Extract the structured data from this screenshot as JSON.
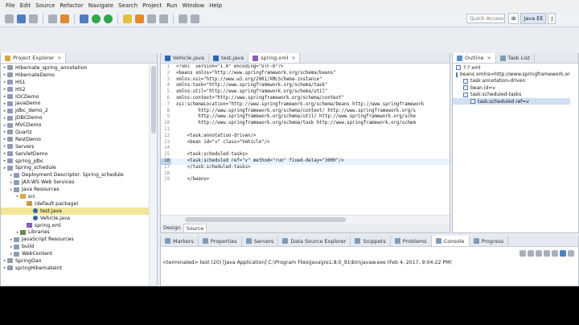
{
  "menu": [
    "File",
    "Edit",
    "Source",
    "Refactor",
    "Navigate",
    "Search",
    "Project",
    "Run",
    "Window",
    "Help"
  ],
  "toolbar": {
    "quick_access": "Quick Access",
    "perspective_label": "Java EE"
  },
  "project_explorer": {
    "tab_label": "Project Explorer",
    "items": [
      {
        "label": "Hibernate_spring_annotation",
        "depth": 0
      },
      {
        "label": "HibernateDemo",
        "depth": 0
      },
      {
        "label": "HS1",
        "depth": 0
      },
      {
        "label": "HS2",
        "depth": 0
      },
      {
        "label": "IOCDemo",
        "depth": 0
      },
      {
        "label": "JavaDemo",
        "depth": 0
      },
      {
        "label": "Jdbc_demo_2",
        "depth": 0
      },
      {
        "label": "JDBCDemo",
        "depth": 0
      },
      {
        "label": "MVCDemo",
        "depth": 0
      },
      {
        "label": "Quartz",
        "depth": 0
      },
      {
        "label": "RestDemo",
        "depth": 0
      },
      {
        "label": "Servers",
        "depth": 0
      },
      {
        "label": "ServletDemo",
        "depth": 0
      },
      {
        "label": "spring_jdbc",
        "depth": 0
      },
      {
        "label": "Spring_schedule",
        "depth": 0
      },
      {
        "label": "Deployment Descriptor: Spring_schedule",
        "depth": 1
      },
      {
        "label": "JAX-WS Web Services",
        "depth": 1
      },
      {
        "label": "Java Resources",
        "depth": 1
      },
      {
        "label": "src",
        "depth": 2
      },
      {
        "label": "(default package)",
        "depth": 3
      },
      {
        "label": "test.java",
        "depth": 4
      },
      {
        "label": "Vehicle.java",
        "depth": 4
      },
      {
        "label": "spring.xml",
        "depth": 3
      },
      {
        "label": "Libraries",
        "depth": 2
      },
      {
        "label": "JavaScript Resources",
        "depth": 1
      },
      {
        "label": "build",
        "depth": 1
      },
      {
        "label": "WebContent",
        "depth": 1
      },
      {
        "label": "SpringDao",
        "depth": 0
      },
      {
        "label": "springHibernateInt",
        "depth": 0
      }
    ]
  },
  "editor": {
    "tabs": [
      {
        "label": "Vehicle.java"
      },
      {
        "label": "test.java"
      },
      {
        "label": "spring.xml"
      }
    ],
    "lines": [
      {
        "num": "1",
        "text": "<?xml  version=\"1.0\" encoding=\"UTF-8\"?>"
      },
      {
        "num": "2",
        "text": "<beans xmlns=\"http://www.springframework.org/schema/beans\""
      },
      {
        "num": "3",
        "text": "xmlns:xsi=\"http://www.w3.org/2001/XMLSchema-instance\""
      },
      {
        "num": "4",
        "text": "xmlns:task=\"http://www.springframework.org/schema/task\""
      },
      {
        "num": "5",
        "text": "xmlns:util=\"http://www.springframework.org/schema/util\""
      },
      {
        "num": "6",
        "text": "xmlns:context=\"http://www.springframework.org/schema/context\""
      },
      {
        "num": "7",
        "text": "xsi:schemaLocation=\"http://www.springframework.org/schema/beans http://www.springframework"
      },
      {
        "num": "8",
        "text": "        http://www.springframework.org/schema/context/ http://www.springframework.org/s"
      },
      {
        "num": "9",
        "text": "        http://www.springframework.org/schema/util/ http://www.springframework.org/sche"
      },
      {
        "num": "10",
        "text": "        http://www.springframework.org/schema/task http://www.springframework.org/schem"
      },
      {
        "num": "11",
        "text": ""
      },
      {
        "num": "12",
        "text": "    <task:annotation-driven/>"
      },
      {
        "num": "13",
        "text": "    <bean id=\"v\" class=\"Vehicle\"/>"
      },
      {
        "num": "14",
        "text": ""
      },
      {
        "num": "15",
        "text": "    <task:scheduled-tasks>"
      },
      {
        "num": "16",
        "text": "    <task:scheduled ref=\"v\" method=\"run\" fixed-delay=\"3000\"/>"
      },
      {
        "num": "17",
        "text": "    </task:scheduled-tasks>"
      },
      {
        "num": "18",
        "text": ""
      },
      {
        "num": "19",
        "text": "    </beans>"
      }
    ],
    "mode_tabs": [
      "Design",
      "Source"
    ]
  },
  "outline": {
    "tabs": [
      "Outline",
      "Task List"
    ],
    "items": [
      {
        "label": "?:? xml",
        "depth": 0
      },
      {
        "label": "beans xmlns=http://www.springframework.org/",
        "depth": 0
      },
      {
        "label": "task:annotation-driven",
        "depth": 1
      },
      {
        "label": "bean id=v",
        "depth": 1
      },
      {
        "label": "task:scheduled-tasks",
        "depth": 1
      },
      {
        "label": "task:scheduled ref=v",
        "depth": 2
      }
    ]
  },
  "bottom": {
    "tabs": [
      "Markers",
      "Properties",
      "Servers",
      "Data Source Explorer",
      "Snippets",
      "Problems",
      "Console",
      "Progress"
    ],
    "status": "<terminated> test (20) [Java Application] C:\\Program Files\\Java\\jre1.8.0_91\\bin\\javaw.exe (Feb 4, 2017, 9:04:22 PM)"
  }
}
